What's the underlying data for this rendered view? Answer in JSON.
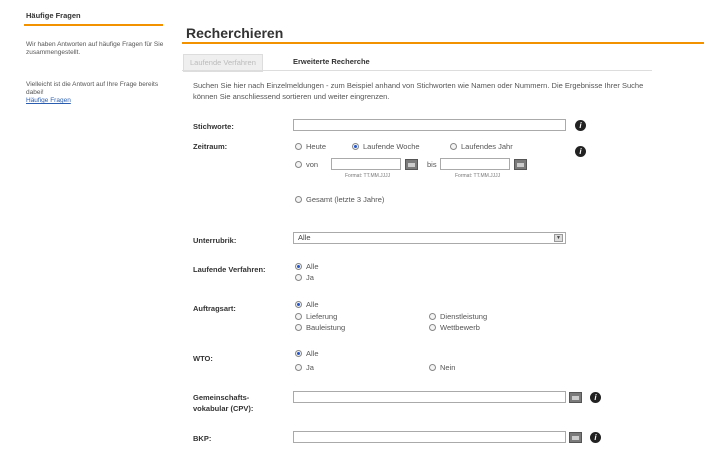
{
  "sidebar": {
    "title": "Häufige Fragen",
    "text1": "Wir haben Antworten auf häufige Fragen für Sie zusammengestellt.",
    "text2": "Vielleicht ist die Antwort auf Ihre Frage bereits dabei!",
    "link": "Häufige Fragen"
  },
  "main": {
    "title": "Recherchieren",
    "tabs": [
      "Laufende Verfahren",
      "Erweiterte Recherche"
    ],
    "intro": "Suchen Sie hier nach Einzelmeldungen - zum Beispiel anhand von Stichworten wie Namen oder Nummern. Die Ergebnisse Ihrer Suche können Sie anschliessend sortieren und weiter eingrenzen."
  },
  "form": {
    "stichworte": {
      "label": "Stichworte:",
      "value": ""
    },
    "zeitraum": {
      "label": "Zeitraum:",
      "options": [
        "Heute",
        "Laufende Woche",
        "Laufendes Jahr"
      ],
      "selected": "Laufende Woche",
      "von": "von",
      "bis": "bis",
      "format": "Format: TT.MM.JJJJ",
      "gesamt": "Gesamt (letzte 3 Jahre)"
    },
    "unterrubrik": {
      "label": "Unterrubrik:",
      "value": "Alle"
    },
    "laufende": {
      "label": "Laufende Verfahren:",
      "options": [
        "Alle",
        "Ja"
      ],
      "selected": "Alle"
    },
    "auftragsart": {
      "label": "Auftragsart:",
      "options": [
        "Alle",
        "Lieferung",
        "Dienstleistung",
        "Bauleistung",
        "Wettbewerb"
      ],
      "selected": "Alle"
    },
    "wto": {
      "label": "WTO:",
      "options": [
        "Alle",
        "Ja",
        "Nein"
      ],
      "selected": "Alle"
    },
    "cpv": {
      "label_line1": "Gemeinschafts-",
      "label_line2": "vokabular (CPV):",
      "value": ""
    },
    "bkp": {
      "label": "BKP:",
      "value": ""
    }
  },
  "colors": {
    "accent": "#f39200",
    "link": "#2a5db0"
  }
}
